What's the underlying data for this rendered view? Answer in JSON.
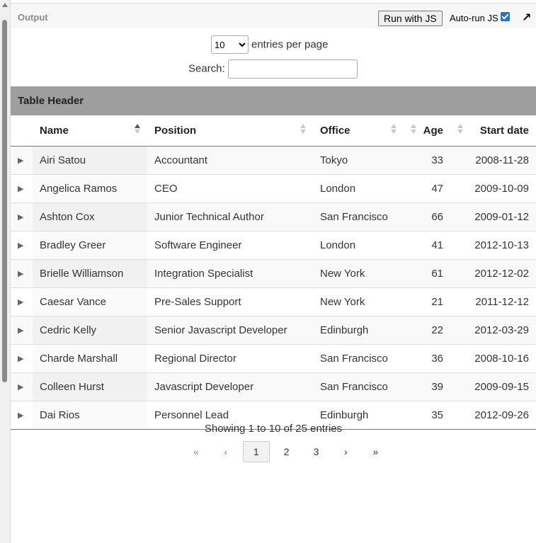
{
  "toolbar": {
    "title": "Output",
    "run_label": "Run with JS",
    "autorun_label": "Auto-run JS",
    "autorun_checked": true,
    "popout_icon": "arrow-up-right-icon"
  },
  "controls": {
    "entries_value": "10",
    "entries_label": "entries per page",
    "search_label": "Search:",
    "search_value": ""
  },
  "table": {
    "caption": "Table Header",
    "columns": [
      "Name",
      "Position",
      "Office",
      "Age",
      "Start date"
    ],
    "rows": [
      {
        "name": "Airi Satou",
        "position": "Accountant",
        "office": "Tokyo",
        "age": "33",
        "start": "2008-11-28"
      },
      {
        "name": "Angelica Ramos",
        "position": "CEO",
        "office": "London",
        "age": "47",
        "start": "2009-10-09"
      },
      {
        "name": "Ashton Cox",
        "position": "Junior Technical Author",
        "office": "San Francisco",
        "age": "66",
        "start": "2009-01-12"
      },
      {
        "name": "Bradley Greer",
        "position": "Software Engineer",
        "office": "London",
        "age": "41",
        "start": "2012-10-13"
      },
      {
        "name": "Brielle Williamson",
        "position": "Integration Specialist",
        "office": "New York",
        "age": "61",
        "start": "2012-12-02"
      },
      {
        "name": "Caesar Vance",
        "position": "Pre-Sales Support",
        "office": "New York",
        "age": "21",
        "start": "2011-12-12"
      },
      {
        "name": "Cedric Kelly",
        "position": "Senior Javascript Developer",
        "office": "Edinburgh",
        "age": "22",
        "start": "2012-03-29"
      },
      {
        "name": "Charde Marshall",
        "position": "Regional Director",
        "office": "San Francisco",
        "age": "36",
        "start": "2008-10-16"
      },
      {
        "name": "Colleen Hurst",
        "position": "Javascript Developer",
        "office": "San Francisco",
        "age": "39",
        "start": "2009-09-15"
      },
      {
        "name": "Dai Rios",
        "position": "Personnel Lead",
        "office": "Edinburgh",
        "age": "35",
        "start": "2012-09-26"
      }
    ]
  },
  "info": "Showing 1 to 10 of 25 entries",
  "pagination": {
    "first": "«",
    "prev": "‹",
    "pages": [
      "1",
      "2",
      "3"
    ],
    "current": "1",
    "next": "›",
    "last": "»"
  }
}
